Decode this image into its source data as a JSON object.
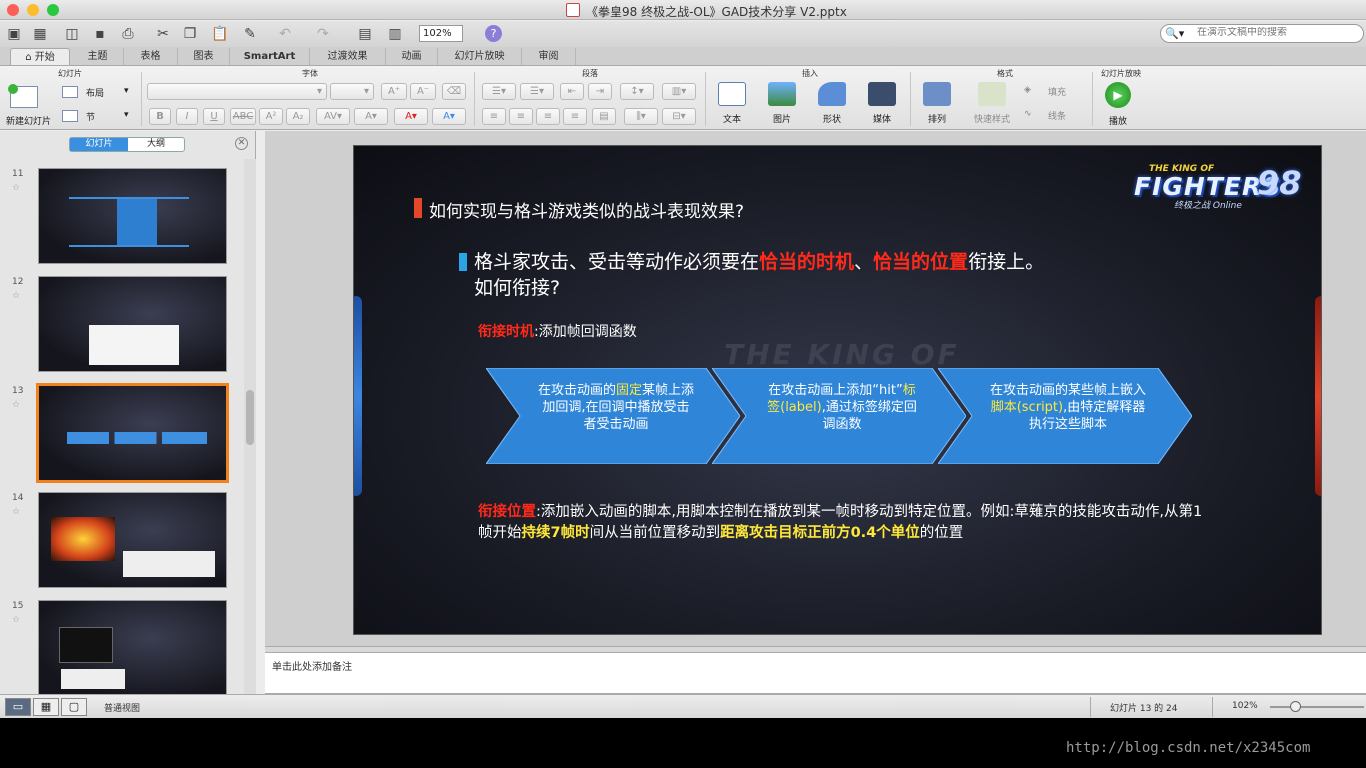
{
  "window": {
    "title": "《拳皇98 终极之战-OL》GAD技术分享 V2.pptx",
    "traffic_lights": [
      "#fc5f57",
      "#fdbc2e",
      "#29c840"
    ]
  },
  "toolbar": {
    "zoom": "102%",
    "search_placeholder": "在演示文稿中的搜索",
    "icons": [
      "new-icon",
      "template-icon",
      "open-icon",
      "save-icon",
      "print-icon",
      "cut-icon",
      "copy-icon",
      "paste-icon",
      "format-painter-icon",
      "undo-icon",
      "redo-icon",
      "slide-show-icon",
      "view-icon",
      "help-icon"
    ]
  },
  "ribbon_tabs": [
    "开始",
    "主题",
    "表格",
    "图表",
    "SmartArt",
    "过渡效果",
    "动画",
    "幻灯片放映",
    "审阅"
  ],
  "ribbon": {
    "groups": {
      "slides": "幻灯片",
      "font": "字体",
      "paragraph": "段落",
      "insert": "插入",
      "format": "格式",
      "slideshow": "幻灯片放映"
    },
    "new_slide": "新建幻灯片",
    "layout": "布局",
    "section": "节",
    "insert_text": "文本",
    "insert_picture": "图片",
    "insert_shape": "形状",
    "insert_media": "媒体",
    "arrange": "排列",
    "quick_styles": "快速样式",
    "fill": "填充",
    "line": "线条",
    "play": "播放"
  },
  "left_pane": {
    "tab_slides": "幻灯片",
    "tab_outline": "大纲",
    "thumbnails": [
      {
        "num": "11",
        "selected": false
      },
      {
        "num": "12",
        "selected": false
      },
      {
        "num": "13",
        "selected": true
      },
      {
        "num": "14",
        "selected": false
      },
      {
        "num": "15",
        "selected": false
      }
    ],
    "star": "☆"
  },
  "slide": {
    "logo_top": "THE KING OF",
    "logo_main": "FIGHTERS",
    "logo_num": "98",
    "logo_sub": "终极之战 Online",
    "bg_text": "THE KING OF",
    "heading": "如何实现与格斗游戏类似的战斗表现效果?",
    "point_a": "格斗家攻击、受击等动作必须要在",
    "point_red1": "恰当的时机",
    "point_b": "、",
    "point_red2": "恰当的位置",
    "point_c": "衔接上。",
    "point_line2": "如何衔接?",
    "timing_label": "衔接时机",
    "timing_text": ":添加帧回调函数",
    "chevrons": [
      {
        "a": "在攻击动画的",
        "hl": "固定",
        "b": "某帧上添加回调,在回调中播放受击者受击动画"
      },
      {
        "a": "在攻击动画上添加“hit”",
        "hl": "标签(label)",
        "b": ",通过标签绑定回调函数"
      },
      {
        "a": "在攻击动画的某些帧上嵌入",
        "hl": "脚本(script)",
        "b": ",由特定解释器执行这些脚本"
      }
    ],
    "position_label": "衔接位置",
    "position_a": ":添加嵌入动画的脚本,用脚本控制在播放到某一帧时移动到特定位置。例如:草薙京的技能攻击动作,从第1帧开始",
    "position_hl1": "持续7帧时",
    "position_b": "间从当前位置移动到",
    "position_hl2": "距离攻击目标正前方0.4个单位",
    "position_c": "的位置"
  },
  "notes": {
    "placeholder": "单击此处添加备注"
  },
  "status": {
    "view_label": "普通视图",
    "slide_counter": "幻灯片 13 的 24",
    "zoom": "102%"
  },
  "watermark": "http://blog.csdn.net/x2345com",
  "colors": {
    "accent_blue": "#3b8fe0",
    "selection_orange": "#f0821e",
    "slide_red": "#ff2a1a",
    "slide_yellow": "#ffe83a",
    "chevron_blue": "#2f86d8"
  }
}
